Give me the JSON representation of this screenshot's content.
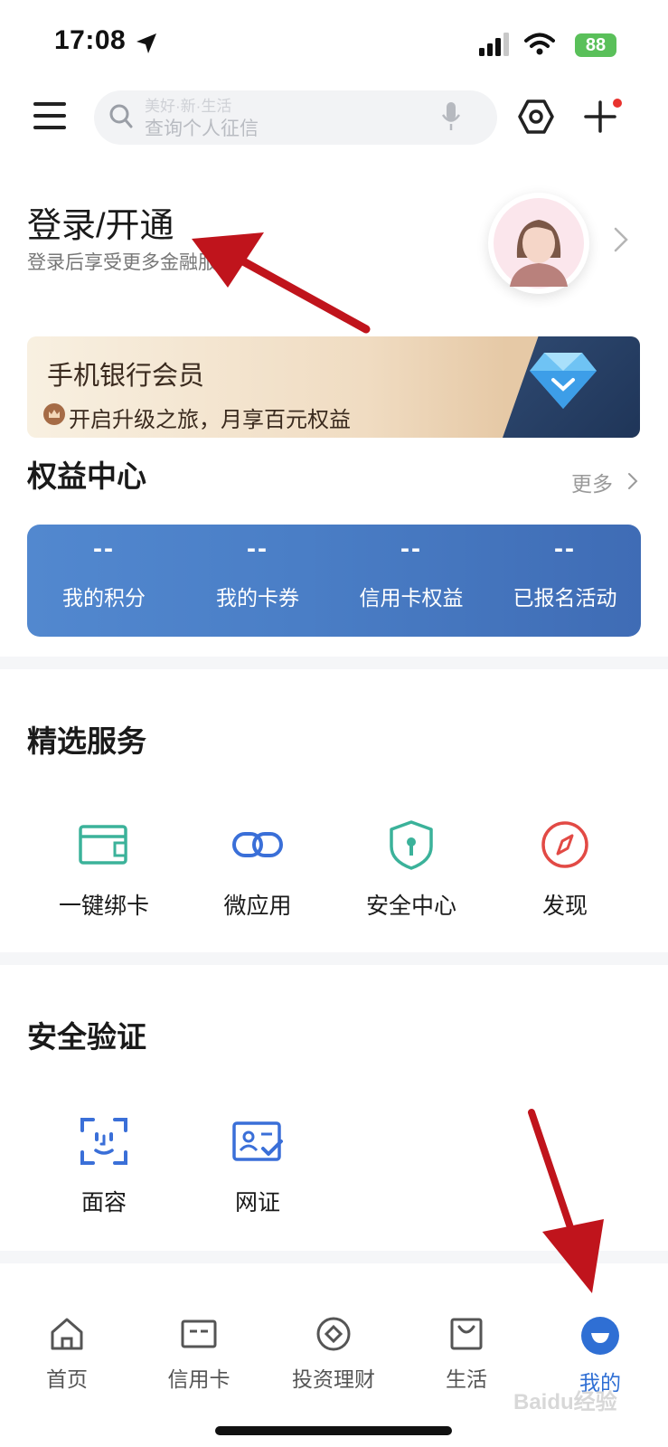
{
  "status_bar": {
    "time": "17:08",
    "battery": "88"
  },
  "search": {
    "ghost_text": "美好·新·生活",
    "placeholder": "查询个人征信"
  },
  "login": {
    "title": "登录/开通",
    "subtitle": "登录后享受更多金融服务"
  },
  "member_banner": {
    "title": "手机银行会员",
    "subtitle": "开启升级之旅，月享百元权益"
  },
  "benefits": {
    "title": "权益中心",
    "more": "更多",
    "items": [
      {
        "value": "--",
        "label": "我的积分"
      },
      {
        "value": "--",
        "label": "我的卡券"
      },
      {
        "value": "--",
        "label": "信用卡权益"
      },
      {
        "value": "--",
        "label": "已报名活动"
      }
    ]
  },
  "featured": {
    "title": "精选服务",
    "items": [
      {
        "label": "一键绑卡",
        "icon": "bind-card-icon",
        "color": "#3bb29a"
      },
      {
        "label": "微应用",
        "icon": "link-icon",
        "color": "#3a6fd8"
      },
      {
        "label": "安全中心",
        "icon": "shield-icon",
        "color": "#3bb29a"
      },
      {
        "label": "发现",
        "icon": "compass-icon",
        "color": "#e24a45"
      }
    ]
  },
  "security": {
    "title": "安全验证",
    "items": [
      {
        "label": "面容",
        "icon": "face-id-icon",
        "color": "#3a6fd8"
      },
      {
        "label": "网证",
        "icon": "id-card-icon",
        "color": "#3a6fd8"
      }
    ]
  },
  "tabbar": {
    "active_color": "#2f6fd4",
    "items": [
      {
        "label": "首页",
        "icon": "home-icon"
      },
      {
        "label": "信用卡",
        "icon": "credit-card-icon"
      },
      {
        "label": "投资理财",
        "icon": "invest-icon"
      },
      {
        "label": "生活",
        "icon": "shopping-bag-icon"
      },
      {
        "label": "我的",
        "icon": "profile-icon"
      }
    ]
  },
  "watermark": "Baidu经验"
}
